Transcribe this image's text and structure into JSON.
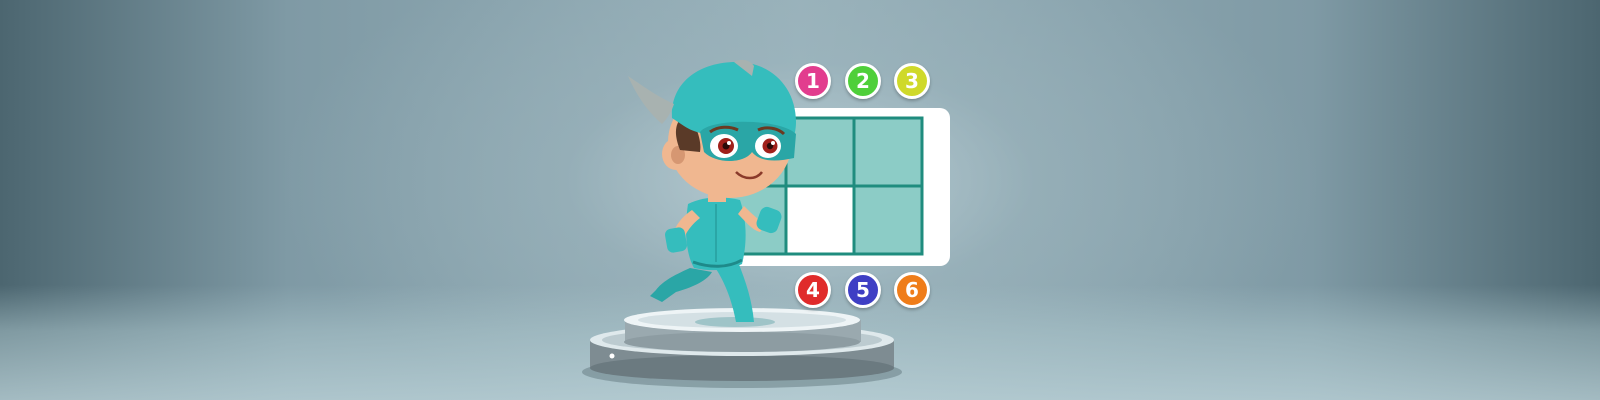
{
  "scene": {
    "colors": {
      "background": "#97b0b9",
      "board_frame": "#ffffff",
      "grid_line": "#1f8c7e",
      "cell_filled": "#8cccc6",
      "cell_empty": "#ffffff",
      "hero_suit": "#35bdbd"
    },
    "board": {
      "rows": 2,
      "cols": 3,
      "cells": [
        "filled",
        "filled",
        "filled",
        "filled",
        "empty",
        "filled"
      ]
    },
    "number_tiles": [
      {
        "label": "1",
        "color": "#e23d8e",
        "icon": "number-tile"
      },
      {
        "label": "2",
        "color": "#4fcf3a",
        "icon": "number-tile"
      },
      {
        "label": "3",
        "color": "#cfd92a",
        "icon": "number-tile"
      },
      {
        "label": "4",
        "color": "#e02b2b",
        "icon": "number-tile"
      },
      {
        "label": "5",
        "color": "#3f3fc4",
        "icon": "number-tile"
      },
      {
        "label": "6",
        "color": "#ef7d1a",
        "icon": "number-tile"
      }
    ],
    "character": {
      "icon": "masked-superhero-kid"
    },
    "pedestal": {
      "icon": "silver-podium"
    }
  }
}
